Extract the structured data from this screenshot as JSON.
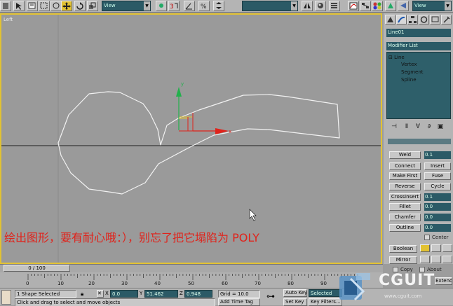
{
  "toolbar": {
    "view_dropdown_1": "View",
    "view_dropdown_2": "View",
    "selection_set": ""
  },
  "viewport": {
    "label": "Left",
    "axis_y": "y",
    "axis_x": "x",
    "overlay_text": "绘出图形，要有耐心哦：），别忘了把它塌陷为 POLY"
  },
  "command_panel": {
    "object_name": "Line01",
    "modifier_list": "Modifier List",
    "stack": [
      {
        "label": "Line",
        "prefix": "⊟"
      },
      {
        "label": "Vertex",
        "prefix": ""
      },
      {
        "label": "Segment",
        "prefix": ""
      },
      {
        "label": "Spline",
        "prefix": ""
      }
    ],
    "weld_label": "Weld",
    "weld_value": "0.1",
    "connect": "Connect",
    "insert": "Insert",
    "make_first": "Make First",
    "fuse": "Fuse",
    "reverse": "Reverse",
    "cycle": "Cycle",
    "crossinsert": "CrossInsert",
    "crossinsert_value": "0.1",
    "fillet": "Fillet",
    "fillet_value": "0.0",
    "chamfer": "Chamfer",
    "chamfer_value": "0.0",
    "outline": "Outline",
    "outline_value": "0.0",
    "center_label": "Center",
    "boolean": "Boolean",
    "mirror": "Mirror",
    "copy_label": "Copy",
    "about_label": "About",
    "extend": "Extend"
  },
  "timeline": {
    "slider": "0 / 100",
    "ticks": [
      "0",
      "10",
      "20",
      "30",
      "40",
      "50",
      "60",
      "70",
      "80",
      "90"
    ]
  },
  "status": {
    "selected": "1 Shape Selected",
    "prompt": "Click and drag to select and move objects",
    "x_label": "X",
    "x_value": "0.0",
    "y_label": "Y",
    "y_value": "51.462",
    "z_label": "Z",
    "z_value": "0.948",
    "grid": "Grid = 10.0",
    "add_time_tag": "Add Time Tag",
    "auto_key": "Auto Key",
    "set_key": "Set Key",
    "selected_dd": "Selected",
    "key_filters": "Key Filters..."
  },
  "watermark": {
    "logo": "CGUIT",
    "url": "www.cguit.com"
  },
  "colors": {
    "viewport_border": "#e2c232",
    "overlay_text": "#e0231b",
    "field_bg": "#2b5a66",
    "spline": "#f2f2f2",
    "axis_x": "#e0231b",
    "axis_y": "#22b14c"
  }
}
